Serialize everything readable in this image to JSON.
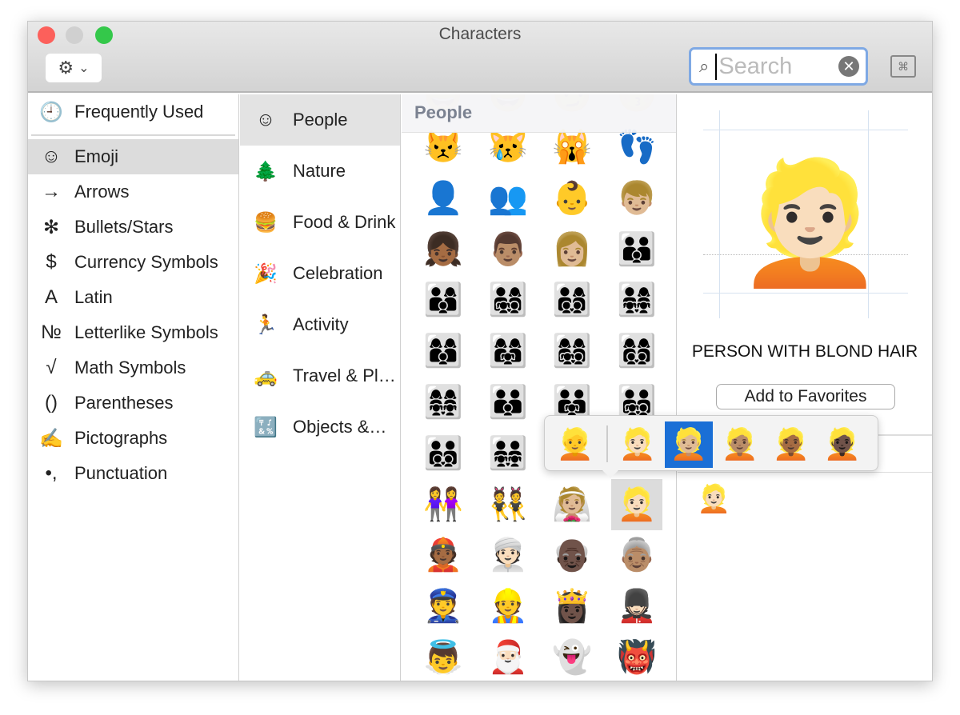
{
  "window": {
    "title": "Characters"
  },
  "toolbar": {
    "gear_chevron": "⌄",
    "search_placeholder": "Search",
    "search_value": "",
    "clear": "✕",
    "keyboard_viewer": "⌘"
  },
  "sidebar": {
    "items": [
      {
        "icon": "🕘",
        "label": "Frequently Used",
        "icon_name": "clock-icon"
      },
      {
        "icon": "☺",
        "label": "Emoji",
        "icon_name": "smiley-icon",
        "selected": true
      },
      {
        "icon": "→",
        "label": "Arrows",
        "icon_name": "arrow-icon"
      },
      {
        "icon": "✻",
        "label": "Bullets/Stars",
        "icon_name": "asterisk-icon"
      },
      {
        "icon": "$",
        "label": "Currency Symbols",
        "icon_name": "dollar-icon"
      },
      {
        "icon": "A",
        "label": "Latin",
        "icon_name": "latin-a-icon"
      },
      {
        "icon": "№",
        "label": "Letterlike Symbols",
        "icon_name": "numero-icon"
      },
      {
        "icon": "√",
        "label": "Math Symbols",
        "icon_name": "sqrt-icon"
      },
      {
        "icon": "()",
        "label": "Parentheses",
        "icon_name": "parentheses-icon"
      },
      {
        "icon": "✍",
        "label": "Pictographs",
        "icon_name": "writing-hand-icon"
      },
      {
        "icon": "•,",
        "label": "Punctuation",
        "icon_name": "punctuation-icon"
      }
    ]
  },
  "categories": {
    "items": [
      {
        "icon": "☺",
        "label": "People",
        "selected": true
      },
      {
        "icon": "🌲",
        "label": "Nature"
      },
      {
        "icon": "🍔",
        "label": "Food & Drink"
      },
      {
        "icon": "🎉",
        "label": "Celebration"
      },
      {
        "icon": "🏃",
        "label": "Activity"
      },
      {
        "icon": "🚕",
        "label": "Travel & Pl…"
      },
      {
        "icon": "🔣",
        "label": "Objects &…"
      }
    ]
  },
  "grid": {
    "header": "People",
    "top_partial": [
      "😀",
      "😀",
      "😏",
      "😚"
    ],
    "rows": [
      [
        "😾",
        "😿",
        "🙀",
        "👣"
      ],
      [
        "👤",
        "👥",
        "👶",
        "👦🏼"
      ],
      [
        "👧🏾",
        "👨🏽",
        "👩🏼",
        "👪"
      ],
      [
        "👨‍👩‍👦",
        "👨‍👩‍👧‍👦",
        "👨‍👩‍👦‍👦",
        "👨‍👩‍👧‍👧"
      ],
      [
        "👩‍👩‍👦",
        "👩‍👩‍👧",
        "👩‍👩‍👧‍👦",
        "👩‍👩‍👦‍👦"
      ],
      [
        "👩‍👩‍👧‍👧",
        "👨‍👨‍👦",
        "👨‍👨‍👧",
        "👨‍👨‍👧‍👦"
      ],
      [
        "👨‍👨‍👦‍👦",
        "👨‍👨‍👧‍👧",
        "",
        ""
      ],
      [
        "👭",
        "👯",
        "👰🏼",
        "👱🏻"
      ],
      [
        "👲🏾",
        "👳🏻",
        "👴🏿",
        "👵🏽"
      ],
      [
        "👮",
        "👷",
        "👸🏿",
        "💂🏻"
      ],
      [
        "👼",
        "🎅🏻",
        "👻",
        "👹"
      ]
    ],
    "selected": "👱🏻"
  },
  "detail": {
    "glyph": "👱🏻",
    "name": "PERSON WITH BLOND HAIR",
    "add_favorites": "Add to Favorites",
    "favorites": [
      "👱🏻"
    ]
  },
  "skin_popup": {
    "options": [
      "👱",
      "👱🏻",
      "👱🏼",
      "👱🏽",
      "👱🏾",
      "👱🏿"
    ],
    "selected_index": 2
  },
  "colors": {
    "accent": "#1a6fd6",
    "close": "#fc605b",
    "minimize": "#d0d0d0",
    "zoom": "#34c84a",
    "search_focus": "#7fa9e4"
  }
}
